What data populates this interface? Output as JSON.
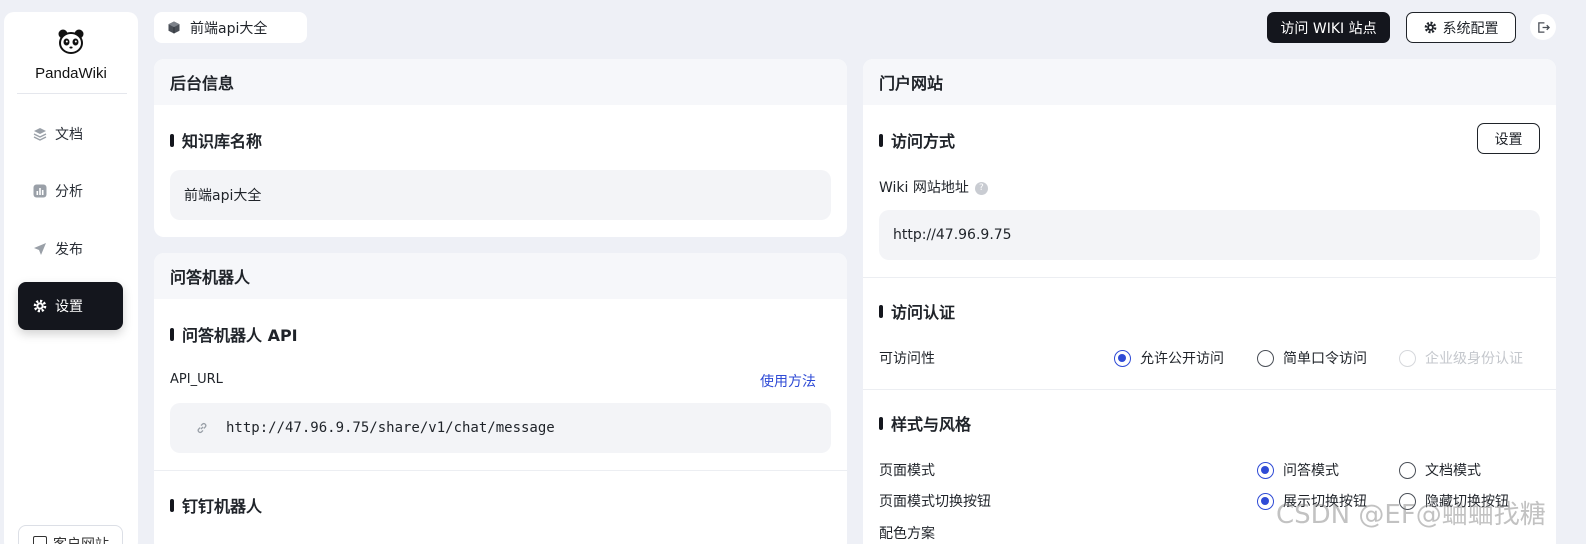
{
  "sidebar": {
    "brand": "PandaWiki",
    "items": [
      {
        "label": "文档",
        "icon": "layers-icon"
      },
      {
        "label": "分析",
        "icon": "chart-icon"
      },
      {
        "label": "发布",
        "icon": "send-icon"
      },
      {
        "label": "设置",
        "icon": "gear-icon",
        "active": true
      }
    ],
    "bottom_label": "客户网站"
  },
  "topbar": {
    "kb_name": "前端api大全",
    "visit_wiki": "访问 WIKI 站点",
    "system_config": "系统配置"
  },
  "backend_card": {
    "title": "后台信息",
    "kb_name_section": "知识库名称",
    "kb_name_value": "前端api大全"
  },
  "bot_card": {
    "title": "问答机器人",
    "api_section": "问答机器人 API",
    "api_url_label": "API_URL",
    "usage_link": "使用方法",
    "api_url_value": "http://47.96.9.75/share/v1/chat/message",
    "dingtalk_section": "钉钉机器人"
  },
  "portal_card": {
    "title": "门户网站",
    "access_section": "访问方式",
    "set_button": "设置",
    "wiki_url_label": "Wiki 网站地址",
    "wiki_url_value": "http://47.96.9.75",
    "auth_section": "访问认证",
    "accessibility_label": "可访问性",
    "access_options": [
      {
        "label": "允许公开访问",
        "checked": true,
        "disabled": false
      },
      {
        "label": "简单口令访问",
        "checked": false,
        "disabled": false
      },
      {
        "label": "企业级身份认证",
        "checked": false,
        "disabled": true
      }
    ],
    "style_section": "样式与风格",
    "page_mode_label": "页面模式",
    "page_mode_options": [
      {
        "label": "问答模式",
        "checked": true
      },
      {
        "label": "文档模式",
        "checked": false
      }
    ],
    "mode_switch_label": "页面模式切换按钮",
    "mode_switch_options": [
      {
        "label": "展示切换按钮",
        "checked": true
      },
      {
        "label": "隐藏切换按钮",
        "checked": false
      }
    ],
    "color_scheme_label": "配色方案"
  },
  "watermark": "CSDN @EF@蛐蛐找糖",
  "colors": {
    "accent": "#2f4bd6",
    "dark": "#14161d",
    "background": "#eef0f6"
  }
}
